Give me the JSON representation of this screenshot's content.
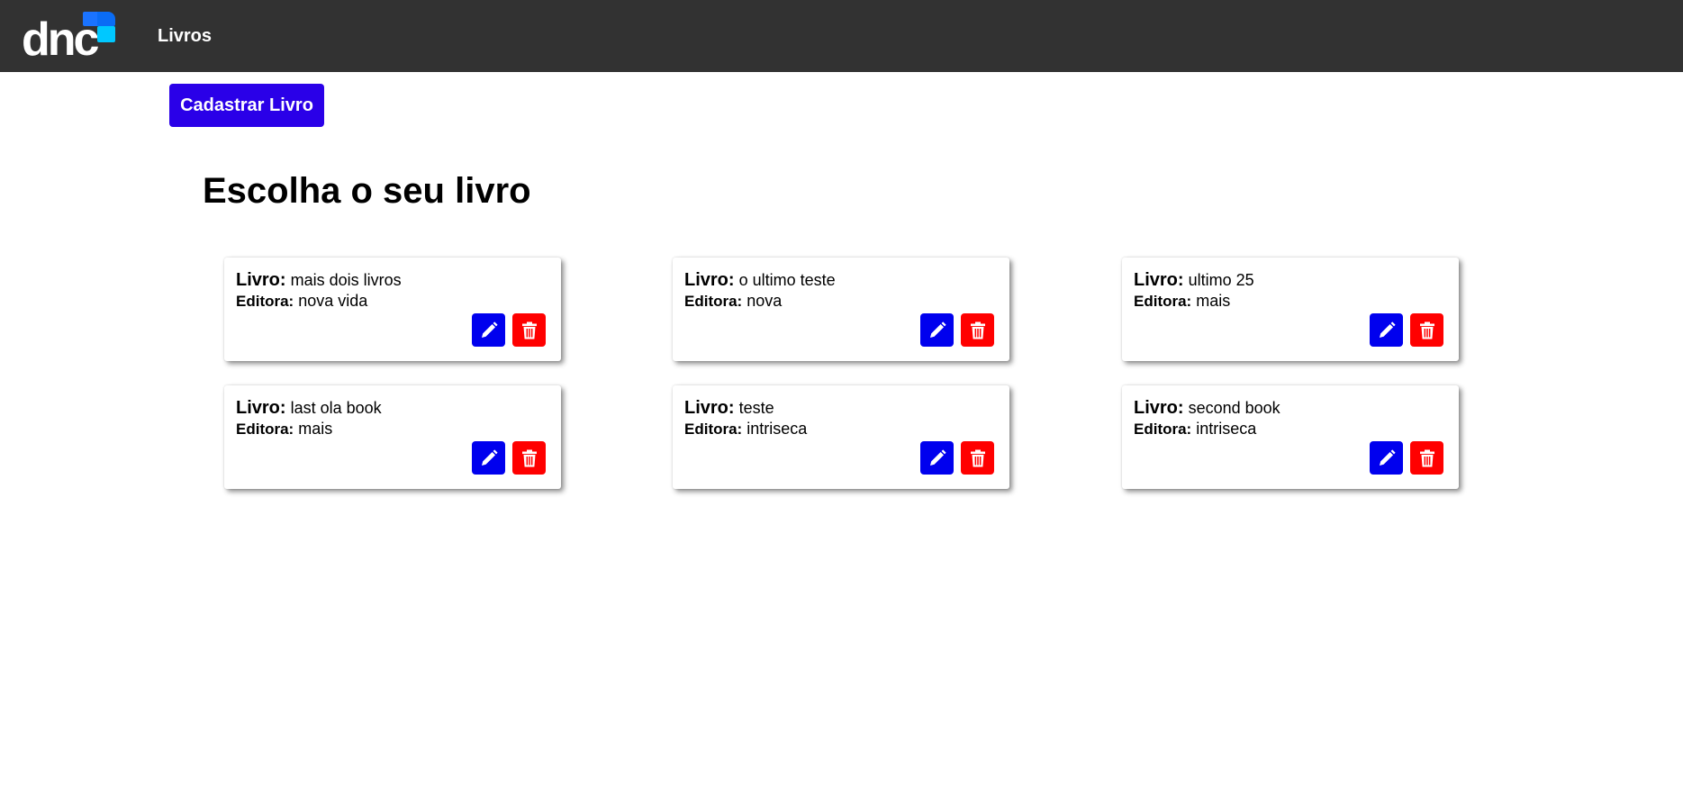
{
  "header": {
    "logo_text": "dnc",
    "nav_link": "Livros"
  },
  "actions": {
    "register_label": "Cadastrar Livro"
  },
  "main": {
    "title": "Escolha o seu livro"
  },
  "labels": {
    "book": "Livro:",
    "publisher": "Editora:"
  },
  "books": [
    {
      "title": "mais dois livros",
      "publisher": "nova vida"
    },
    {
      "title": "o ultimo teste",
      "publisher": "nova"
    },
    {
      "title": "ultimo 25",
      "publisher": "mais"
    },
    {
      "title": "last ola book",
      "publisher": "mais"
    },
    {
      "title": "teste",
      "publisher": "intriseca"
    },
    {
      "title": "second book",
      "publisher": "intriseca"
    }
  ],
  "icons": {
    "edit": "pencil-icon",
    "delete": "trash-icon"
  },
  "colors": {
    "topbar": "#323232",
    "primary_button": "#2a00e8",
    "edit_button": "#0000ee",
    "delete_button": "#ff0000",
    "logo_blue": "#1a73ff",
    "logo_cyan": "#00c8ff"
  }
}
